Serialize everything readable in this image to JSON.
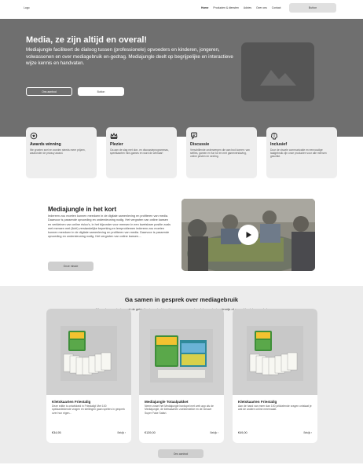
{
  "nav": {
    "logo": "Logo",
    "links": [
      "Home",
      "Producten & diensten",
      "Advies",
      "Over ons",
      "Contact"
    ],
    "button": "Button"
  },
  "hero": {
    "title": "Media, ze zijn altijd en overal!",
    "text": "Mediajungle faciliteert de dialoog tussen (professionele) opvoeders en kinderen, jongeren, volwassenen en over mediagebruik en-gedrag. Mediajungle deelt op begrijpelijke en interactieve wijze kennis en handvaten.",
    "btn_primary": "Ons aanbod",
    "btn_secondary": "Button",
    "image_icon": "image-placeholder-icon"
  },
  "features": [
    {
      "icon": "award-icon",
      "title": "Awards winning",
      "desc": "We groeien snel en worden steeds meer prijzen, waaronder de privacy award."
    },
    {
      "icon": "crown-icon",
      "title": "Plezier",
      "desc": "Ga aan de slag met doe- en discussieprogrammas, speelkaarten mini-games en word de winnaar!"
    },
    {
      "icon": "chat-icon",
      "title": "Discussie",
      "desc": "Verschillende onderwerpen die aan bod komen: van selfies, gamen en fun tot en met gameverslaving, online pesten en sexting."
    },
    {
      "icon": "brain-icon",
      "title": "Inclusief",
      "desc": "Door de visuele communicatie en eenvoudige taalgebruik zijn onze producten voor alle mensen geschikt."
    }
  ],
  "intro": {
    "title": "Mediajungle in het kort",
    "text": "Iedereen zou moeten kunnen meedoen in de digitale samenleving en profiteren van media. Daarvoor is passende opvoeding en ondersteuning nodig. Het vergroten van online kansen en verkleinen van online risico's, in het bijzonder voor mensen in een kwetsbare positie zoals met mensen met (licht) verstandelijke beperking en leerproblemen iedereen zou moeten kunnen meedoen in de digitale samenleving en profiteren van media. Daarvoor is passende opvoeding en ondersteuning nodig. Het vergroten van online kansen....",
    "button": "Onze missie",
    "play_icon": "play-icon"
  },
  "products": {
    "title": "Ga samen in gesprek over mediagebruik",
    "subtitle": "We maken producten met de gebruiker in gedachten, kies een van onze bundels voor het onderwijs of zorg of bestel een enkel product",
    "items": [
      {
        "title": "Kletskaarten Friestalig",
        "desc": "Deze editie is ontwikkeld in Friestalig! Met 100 spelaanleidende vragen en stellingen gaan spelers in gesprek over hun eigen...",
        "price": "€34,95",
        "more": "Bekijk ›"
      },
      {
        "title": "Mediajungle Totaalpakket",
        "desc": "Neem zowel het Mediajungle bordspel met web app als de Mediajungle, de kletskaarten zoekbestelde en de nieuwe Super Fake Safari.",
        "price": "€139,00",
        "more": "Bekijk ›"
      },
      {
        "title": "Kletskaarten Friestalig",
        "desc": "Aan de hand van meer dan 100 prikkelende vragen ontstaat je wat de andere online meemaakt.",
        "price": "€49,00",
        "more": "Bekijk ›"
      }
    ],
    "button": "Ons aanbod"
  }
}
